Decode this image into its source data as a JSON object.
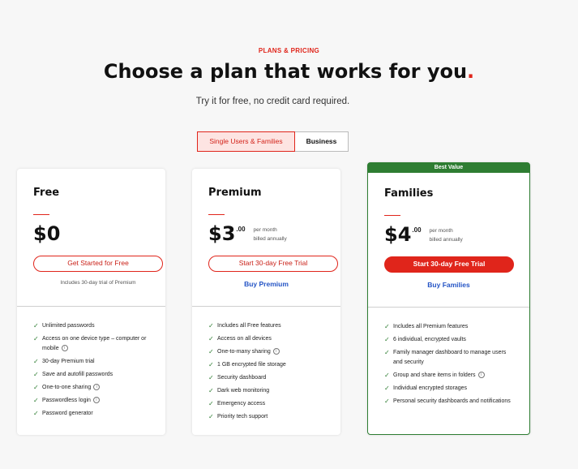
{
  "header": {
    "eyebrow": "PLANS & PRICING",
    "headline": "Choose a plan that works for you",
    "headline_dot": ".",
    "subhead": "Try it for free, no credit card required."
  },
  "toggle": {
    "active_label": "Single Users & Families",
    "inactive_label": "Business"
  },
  "colors": {
    "accent_red": "#e0251b",
    "best_value_green": "#2e7d32",
    "link_blue": "#2454c5"
  },
  "plans": [
    {
      "name": "Free",
      "price": "$0",
      "cents": "",
      "period_line1": "",
      "period_line2": "",
      "cta": "Get Started for Free",
      "note": "Includes 30-day trial of Premium",
      "features": [
        {
          "text": "Unlimited passwords",
          "info": false
        },
        {
          "text": "Access on one device type – computer or mobile",
          "info": true
        },
        {
          "text": "30-day Premium trial",
          "info": false
        },
        {
          "text": "Save and autofill passwords",
          "info": false
        },
        {
          "text": "One-to-one sharing",
          "info": true
        },
        {
          "text": "Passwordless login",
          "info": true
        },
        {
          "text": "Password generator",
          "info": false
        }
      ]
    },
    {
      "name": "Premium",
      "price": "$3",
      "cents": ".00",
      "period_line1": "per month",
      "period_line2": "billed annually",
      "cta": "Start 30-day Free Trial",
      "link": "Buy Premium",
      "features": [
        {
          "text": "Includes all Free features",
          "info": false
        },
        {
          "text": "Access on all devices",
          "info": false
        },
        {
          "text": "One-to-many sharing",
          "info": true
        },
        {
          "text": "1 GB encrypted file storage",
          "info": false
        },
        {
          "text": "Security dashboard",
          "info": false
        },
        {
          "text": "Dark web monitoring",
          "info": false
        },
        {
          "text": "Emergency access",
          "info": false
        },
        {
          "text": "Priority tech support",
          "info": false
        }
      ]
    },
    {
      "badge": "Best Value",
      "name": "Families",
      "price": "$4",
      "cents": ".00",
      "period_line1": "per month",
      "period_line2": "billed annually",
      "cta": "Start 30-day Free Trial",
      "link": "Buy Families",
      "features": [
        {
          "text": "Includes all Premium features",
          "info": false
        },
        {
          "text": "6 individual, encrypted vaults",
          "info": false
        },
        {
          "text": "Family manager dashboard to manage users and security",
          "info": false
        },
        {
          "text": "Group and share items in folders",
          "info": true
        },
        {
          "text": "Individual encrypted storages",
          "info": false
        },
        {
          "text": "Personal security dashboards and notifications",
          "info": false
        }
      ]
    }
  ]
}
